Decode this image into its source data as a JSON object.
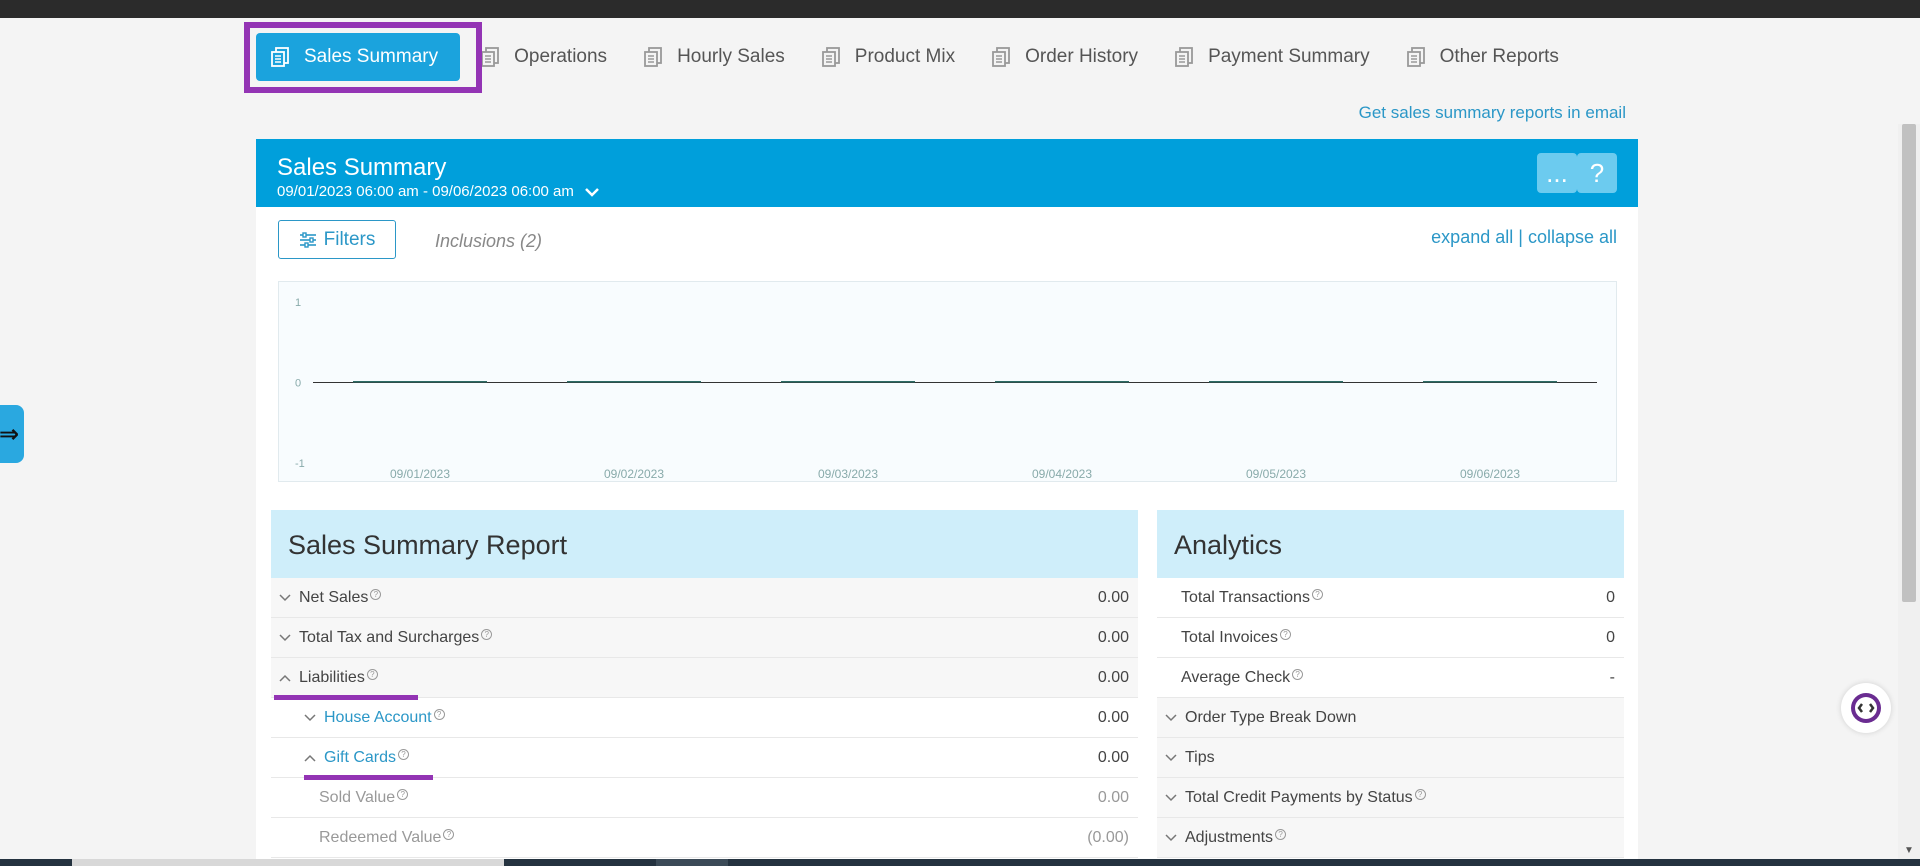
{
  "tabs": [
    {
      "label": "Sales Summary",
      "active": true
    },
    {
      "label": "Operations"
    },
    {
      "label": "Hourly Sales"
    },
    {
      "label": "Product Mix"
    },
    {
      "label": "Order History"
    },
    {
      "label": "Payment Summary"
    },
    {
      "label": "Other Reports"
    }
  ],
  "email_link": "Get sales summary reports in email",
  "panel": {
    "title": "Sales Summary",
    "date_range": "09/01/2023 06:00 am - 09/06/2023 06:00 am",
    "more_label": "...",
    "help_label": "?"
  },
  "filters": {
    "label": "Filters",
    "inclusions": "Inclusions (2)",
    "expand_all": "expand all",
    "separator": " | ",
    "collapse_all": "collapse all"
  },
  "chart_data": {
    "type": "bar",
    "categories": [
      "09/01/2023",
      "09/02/2023",
      "09/03/2023",
      "09/04/2023",
      "09/05/2023",
      "09/06/2023"
    ],
    "values": [
      0,
      0,
      0,
      0,
      0,
      0
    ],
    "yticks": [
      "1",
      "0",
      "-1"
    ],
    "ylim": [
      -1,
      1
    ],
    "grid": false
  },
  "report": {
    "title": "Sales Summary Report",
    "rows": [
      {
        "label": "Net Sales",
        "value": "0.00"
      },
      {
        "label": "Total Tax and Surcharges",
        "value": "0.00"
      },
      {
        "label": "Liabilities",
        "value": "0.00"
      },
      {
        "label": "House Account",
        "value": "0.00"
      },
      {
        "label": "Gift Cards",
        "value": "0.00"
      },
      {
        "label": "Sold Value",
        "value": "0.00"
      },
      {
        "label": "Redeemed Value",
        "value": "(0.00)"
      }
    ]
  },
  "analytics": {
    "title": "Analytics",
    "rows": [
      {
        "label": "Total Transactions",
        "value": "0"
      },
      {
        "label": "Total Invoices",
        "value": "0"
      },
      {
        "label": "Average Check",
        "value": "-"
      },
      {
        "label": "Order Type Break Down"
      },
      {
        "label": "Tips"
      },
      {
        "label": "Total Credit Payments by Status"
      },
      {
        "label": "Adjustments"
      }
    ]
  },
  "colors": {
    "brand": "#009fdb",
    "accent": "#2b97c7",
    "highlight": "#9334b4",
    "section_header": "#cfeefa"
  },
  "icons": {
    "tab": "report-doc-icon",
    "side_toggle": "arrow-right-icon",
    "bot": "assistant-bot-icon"
  }
}
